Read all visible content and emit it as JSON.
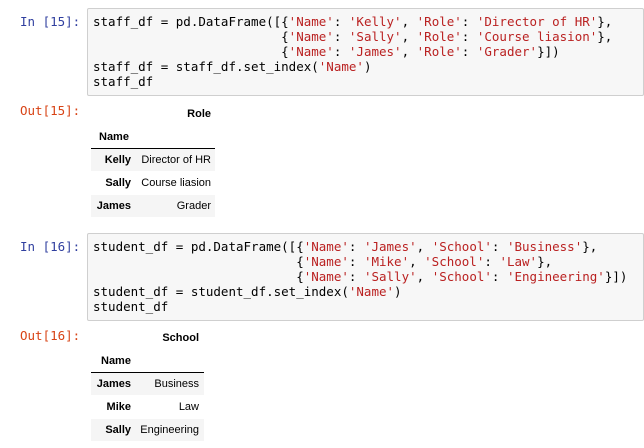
{
  "cells": [
    {
      "in_prompt": "In [15]:",
      "code_lines": [
        [
          {
            "t": "staff_df = pd.DataFrame([{"
          },
          {
            "t": "'Name'",
            "s": 1
          },
          {
            "t": ": "
          },
          {
            "t": "'Kelly'",
            "s": 1
          },
          {
            "t": ", "
          },
          {
            "t": "'Role'",
            "s": 1
          },
          {
            "t": ": "
          },
          {
            "t": "'Director of HR'",
            "s": 1
          },
          {
            "t": "},"
          }
        ],
        [
          {
            "t": "                         {"
          },
          {
            "t": "'Name'",
            "s": 1
          },
          {
            "t": ": "
          },
          {
            "t": "'Sally'",
            "s": 1
          },
          {
            "t": ", "
          },
          {
            "t": "'Role'",
            "s": 1
          },
          {
            "t": ": "
          },
          {
            "t": "'Course liasion'",
            "s": 1
          },
          {
            "t": "},"
          }
        ],
        [
          {
            "t": "                         {"
          },
          {
            "t": "'Name'",
            "s": 1
          },
          {
            "t": ": "
          },
          {
            "t": "'James'",
            "s": 1
          },
          {
            "t": ", "
          },
          {
            "t": "'Role'",
            "s": 1
          },
          {
            "t": ": "
          },
          {
            "t": "'Grader'",
            "s": 1
          },
          {
            "t": "}])"
          }
        ],
        [
          {
            "t": "staff_df = staff_df.set_index("
          },
          {
            "t": "'Name'",
            "s": 1
          },
          {
            "t": ")"
          }
        ],
        [
          {
            "t": "staff_df"
          }
        ]
      ],
      "out_prompt": "Out[15]:",
      "table": {
        "column": "Role",
        "index_name": "Name",
        "rows": [
          {
            "label": "Kelly",
            "value": "Director of HR"
          },
          {
            "label": "Sally",
            "value": "Course liasion"
          },
          {
            "label": "James",
            "value": "Grader"
          }
        ]
      }
    },
    {
      "in_prompt": "In [16]:",
      "code_lines": [
        [
          {
            "t": "student_df = pd.DataFrame([{"
          },
          {
            "t": "'Name'",
            "s": 1
          },
          {
            "t": ": "
          },
          {
            "t": "'James'",
            "s": 1
          },
          {
            "t": ", "
          },
          {
            "t": "'School'",
            "s": 1
          },
          {
            "t": ": "
          },
          {
            "t": "'Business'",
            "s": 1
          },
          {
            "t": "},"
          }
        ],
        [
          {
            "t": "                           {"
          },
          {
            "t": "'Name'",
            "s": 1
          },
          {
            "t": ": "
          },
          {
            "t": "'Mike'",
            "s": 1
          },
          {
            "t": ", "
          },
          {
            "t": "'School'",
            "s": 1
          },
          {
            "t": ": "
          },
          {
            "t": "'Law'",
            "s": 1
          },
          {
            "t": "},"
          }
        ],
        [
          {
            "t": "                           {"
          },
          {
            "t": "'Name'",
            "s": 1
          },
          {
            "t": ": "
          },
          {
            "t": "'Sally'",
            "s": 1
          },
          {
            "t": ", "
          },
          {
            "t": "'School'",
            "s": 1
          },
          {
            "t": ": "
          },
          {
            "t": "'Engineering'",
            "s": 1
          },
          {
            "t": "}])"
          }
        ],
        [
          {
            "t": "student_df = student_df.set_index("
          },
          {
            "t": "'Name'",
            "s": 1
          },
          {
            "t": ")"
          }
        ],
        [
          {
            "t": "student_df"
          }
        ]
      ],
      "out_prompt": "Out[16]:",
      "table": {
        "column": "School",
        "index_name": "Name",
        "rows": [
          {
            "label": "James",
            "value": "Business"
          },
          {
            "label": "Mike",
            "value": "Law"
          },
          {
            "label": "Sally",
            "value": "Engineering"
          }
        ]
      }
    }
  ],
  "colors": {
    "in_prompt": "#303f9f",
    "out_prompt": "#d84315",
    "string": "#ba2121",
    "code_bg": "#f7f7f7"
  }
}
